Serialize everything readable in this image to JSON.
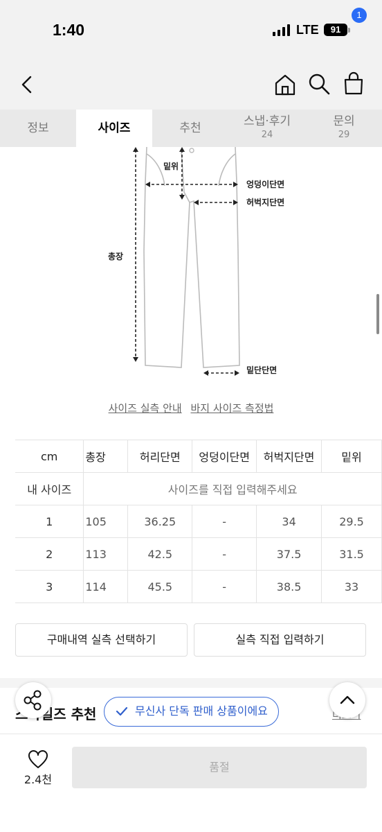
{
  "status_bar": {
    "time": "1:40",
    "network": "LTE",
    "battery": "91"
  },
  "nav": {
    "cart_count": "1"
  },
  "tabs": [
    {
      "label": "정보",
      "count": ""
    },
    {
      "label": "사이즈",
      "count": ""
    },
    {
      "label": "추천",
      "count": ""
    },
    {
      "label": "스냅·후기",
      "count": "24"
    },
    {
      "label": "문의",
      "count": "29"
    }
  ],
  "diagram": {
    "rise": "밑위",
    "hip": "엉덩이단면",
    "thigh": "허벅지단면",
    "total_length": "총장",
    "hem": "밑단단면"
  },
  "guide_links": {
    "size_guide": "사이즈 실측 안내",
    "measure_method": "바지 사이즈 측정법"
  },
  "size_table": {
    "headers": [
      "cm",
      "총장",
      "허리단면",
      "엉덩이단면",
      "허벅지단면",
      "밑위"
    ],
    "my_size_label": "내 사이즈",
    "my_size_placeholder": "사이즈를 직접 입력해주세요",
    "rows": [
      [
        "1",
        "105",
        "36.25",
        "-",
        "34",
        "29.5"
      ],
      [
        "2",
        "113",
        "42.5",
        "-",
        "37.5",
        "31.5"
      ],
      [
        "3",
        "114",
        "45.5",
        "-",
        "38.5",
        "33"
      ]
    ]
  },
  "buttons": {
    "purchase_history": "구매내역 실측 선택하기",
    "direct_input": "실측 직접 입력하기"
  },
  "section": {
    "title": "스타일즈 추천",
    "more": "더보기"
  },
  "exclusive_badge": "무신사 단독 판매 상품이에요",
  "bottom_bar": {
    "like_count": "2.4천",
    "purchase_label": "품절"
  },
  "colors": {
    "accent": "#2a6cf6",
    "pill_border": "#3a6bd8"
  }
}
